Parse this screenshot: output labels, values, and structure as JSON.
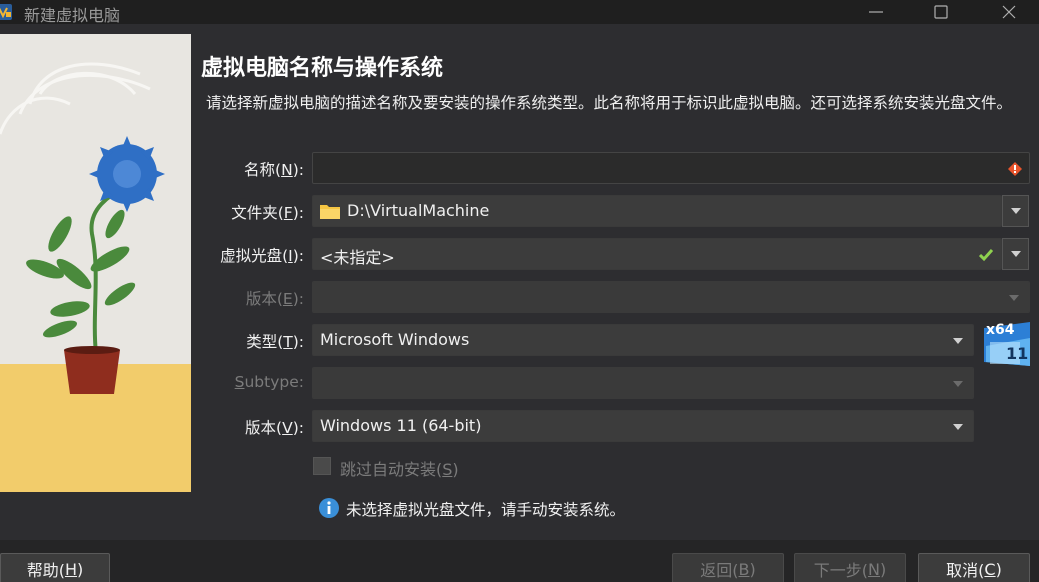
{
  "window": {
    "title": "新建虚拟电脑",
    "minimize_icon": "minimize-icon",
    "maximize_icon": "maximize-icon",
    "close_icon": "close-icon"
  },
  "page": {
    "heading": "虚拟电脑名称与操作系统",
    "description": "请选择新虚拟电脑的描述名称及要安装的操作系统类型。此名称将用于标识此虚拟电脑。还可选择系统安装光盘文件。"
  },
  "form": {
    "name": {
      "label": "名称(",
      "key": "N",
      "label_end": "):",
      "value": "",
      "status_icon": "error-diamond-icon"
    },
    "folder": {
      "label": "文件夹(",
      "key": "F",
      "label_end": "):",
      "value": "D:\\VirtualMachine",
      "icon": "folder-icon"
    },
    "iso": {
      "label": "虚拟光盘(",
      "key": "I",
      "label_end": "):",
      "value": "<未指定>",
      "status_icon": "check-icon"
    },
    "edition": {
      "label": "版本(",
      "key": "E",
      "label_end": "):",
      "value": "",
      "disabled": true
    },
    "type": {
      "label": "类型(",
      "key": "T",
      "label_end": "):",
      "value": "Microsoft Windows",
      "os_icon": "windows-11-x64-icon",
      "os_badge_top": "x64",
      "os_badge_bottom": "11"
    },
    "subtype": {
      "label_key": "S",
      "label_rest": "ubtype:",
      "value": "",
      "disabled": true
    },
    "version": {
      "label": "版本(",
      "key": "V",
      "label_end": "):",
      "value": "Windows 11 (64-bit)"
    },
    "skip_unattended": {
      "label": "跳过自动安装(",
      "key": "S",
      "label_end": ")",
      "checked": false,
      "disabled": true
    },
    "info": {
      "icon": "info-icon",
      "text": "未选择虚拟光盘文件，请手动安装系统。"
    }
  },
  "buttons": {
    "help": {
      "label": "帮助(",
      "key": "H",
      "label_end": ")"
    },
    "back": {
      "label": "返回(",
      "key": "B",
      "label_end": ")",
      "disabled": true
    },
    "next": {
      "label": "下一步(",
      "key": "N",
      "label_end": ")",
      "disabled": true
    },
    "cancel": {
      "label": "取消(",
      "key": "C",
      "label_end": ")"
    }
  },
  "colors": {
    "background": "#2d2d30",
    "titlebar": "#1f1f1f",
    "accent_check": "#8fd14f",
    "error": "#e8542c",
    "info": "#3a8fd8"
  }
}
